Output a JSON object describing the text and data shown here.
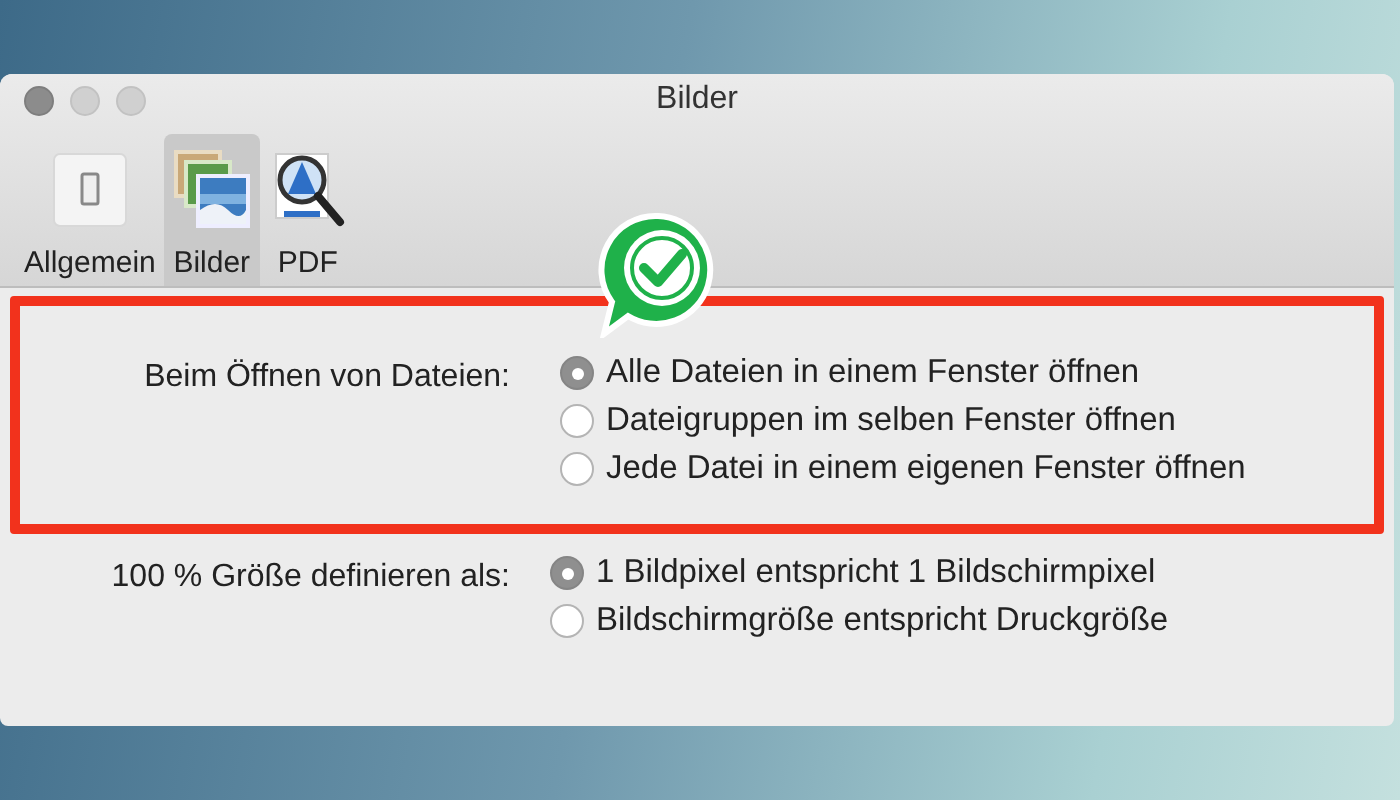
{
  "window": {
    "title": "Bilder"
  },
  "toolbar": [
    {
      "label": "Allgemein",
      "kind": "switch",
      "selected": false
    },
    {
      "label": "Bilder",
      "kind": "photos",
      "selected": true
    },
    {
      "label": "PDF",
      "kind": "pdf",
      "selected": false
    }
  ],
  "groups": [
    {
      "label": "Beim Öffnen von Dateien:",
      "highlighted": true,
      "options": [
        {
          "label": "Alle Dateien in einem Fenster öffnen",
          "selected": true
        },
        {
          "label": "Dateigruppen im selben Fenster öffnen",
          "selected": false
        },
        {
          "label": "Jede Datei in einem eigenen Fenster öffnen",
          "selected": false
        }
      ]
    },
    {
      "label": "100 % Größe definieren als:",
      "highlighted": false,
      "options": [
        {
          "label": "1 Bildpixel entspricht 1 Bildschirmpixel",
          "selected": true
        },
        {
          "label": "Bildschirmgröße entspricht Druckgröße",
          "selected": false
        }
      ]
    }
  ]
}
